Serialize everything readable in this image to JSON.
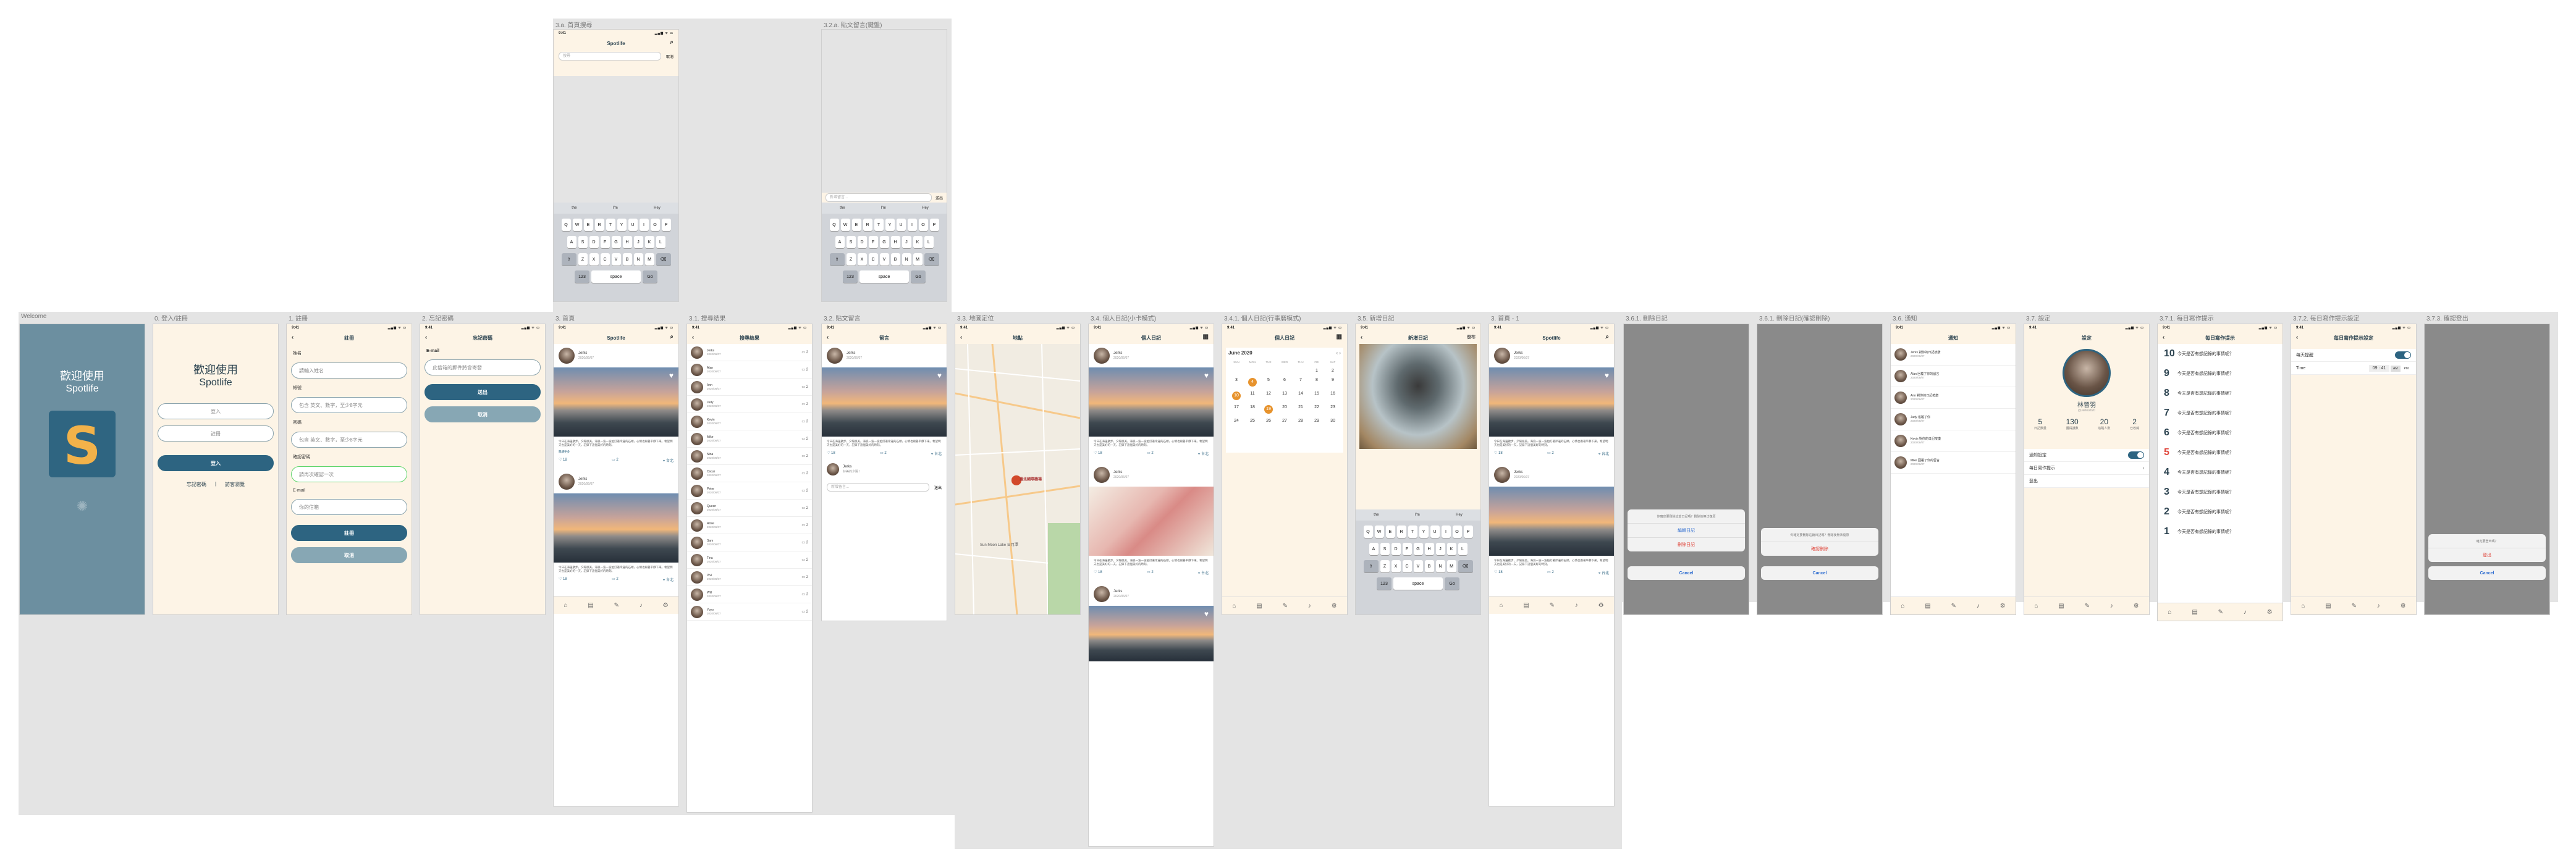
{
  "frames": {
    "welcome": "Welcome",
    "login_register": "0. 登入/註冊",
    "register": "1. 註冊",
    "forgot": "2. 忘記密碼",
    "home": "3. 首頁",
    "home_search": "3.a. 首頁搜尋",
    "home_search_detail": "3.1. 搜尋結果",
    "comment": "3.2. 貼文留言",
    "comment_keyboard": "3.2.a. 貼文留言(鍵盤)",
    "map": "3.3. 地圖定位",
    "personal": "3.4. 個人日記(小卡模式)",
    "personal_cal": "3.4.1. 個人日記(行事曆模式)",
    "new_diary": "3.5. 新增日記",
    "home_v1": "3. 首頁 - 1",
    "del1": "3.6.1. 刪除日記",
    "del2": "3.6.1. 刪除日記(確認刪除)",
    "notify": "3.6. 通知",
    "settings": "3.7. 設定",
    "remind_time": "3.7.1. 每日寫作提示",
    "remind_set": "3.7.2. 每日寫作提示設定",
    "logout": "3.7.3. 確認登出"
  },
  "status": {
    "time": "9:41",
    "bars": "▂▄▆ ᯤ ▭"
  },
  "welcome": {
    "title": "歡迎使用",
    "app": "Spotlife",
    "logo": "S"
  },
  "login": {
    "title": "歡迎使用",
    "app": "Spotlife",
    "signin": "登入",
    "register": "註冊",
    "login_btn": "登入",
    "forgot": "忘記密碼",
    "guest": "訪客瀏覽"
  },
  "register": {
    "nav": "註冊",
    "name_label": "姓名",
    "name_ph": "請輸入姓名",
    "account_label": "帳號",
    "account_ph": "包含 英文、數字，至少8字元",
    "password_label": "密碼",
    "password_ph": "包含 英文、數字，至少8字元",
    "confirm_label": "確認密碼",
    "confirm_ph": "請再次確認一次",
    "email_label": "E-mail",
    "email_ph": "你的信箱",
    "submit": "註冊",
    "cancel": "取消"
  },
  "forgot": {
    "nav": "忘記密碼",
    "email_label": "E-mail",
    "email_ph": "此信箱的郵件將會寄發",
    "send": "送出",
    "cancel": "取消"
  },
  "home": {
    "nav": "Spotlife",
    "user": "Jerks",
    "date": "2020/06/07",
    "likes": "18",
    "comments": "2",
    "loc": "台北",
    "text": "今日在海邊散步，夕陽很美。海浪一波一波拍打著岸邊的石頭，心情也跟著平靜下來。希望明天也是美好的一天，記錄下這個美好的時刻。",
    "more": "閱讀更多"
  },
  "search": {
    "placeholder": "搜尋",
    "cancel": "取消",
    "result_nav": "搜尋結果"
  },
  "results": [
    "Jerks",
    "Alan",
    "Ann",
    "Judy",
    "Kevin",
    "Mike",
    "Nina",
    "Oscar",
    "Peter",
    "Queen",
    "Rose",
    "Sam",
    "Tina",
    "Vivi",
    "Will",
    "Yoyo"
  ],
  "comment": {
    "nav": "留言",
    "placeholder": "新增留言...",
    "send": "送出",
    "author": "Jerks",
    "reply": "好美的夕陽！"
  },
  "map": {
    "nav": "地點",
    "place": "Sun Moon Lake 日月潭",
    "pin": "臺北國際機場"
  },
  "personal": {
    "nav": "個人日記",
    "month": "June 2020"
  },
  "new_diary": {
    "nav": "新增日記",
    "post": "發布"
  },
  "calendar": {
    "days": [
      "SUN",
      "MON",
      "TUE",
      "WED",
      "THU",
      "FRI",
      "SAT"
    ],
    "dates": [
      "",
      "",
      "",
      "",
      "",
      "1",
      "2",
      "3",
      "4",
      "5",
      "6",
      "7",
      "8",
      "9",
      "10",
      "11",
      "12",
      "13",
      "14",
      "15",
      "16",
      "17",
      "18",
      "19",
      "20",
      "21",
      "22",
      "23",
      "24",
      "25",
      "26",
      "27",
      "28",
      "29",
      "30",
      "",
      "",
      ""
    ],
    "marked": [
      "4",
      "10",
      "19"
    ]
  },
  "delete": {
    "message": "你確定要刪除這篇日記嗎？刪除後無法復原",
    "edit": "編輯日記",
    "delete": "刪除日記",
    "cancel": "Cancel",
    "confirm": "確認刪除"
  },
  "notify": {
    "nav": "通知",
    "items": [
      "Jerks 對你的日記按讚",
      "Alan 回覆了你的留言",
      "Ann 對你的日記按讚",
      "Judy 追蹤了你",
      "Kevin 對你的日記按讚",
      "Mike 回覆了你的留言"
    ]
  },
  "settings": {
    "nav": "設定",
    "name": "林晉羽",
    "id": "@Jerks2020",
    "stats": [
      {
        "v": "5",
        "k": "日記數量"
      },
      {
        "v": "130",
        "k": "獲得讚數"
      },
      {
        "v": "20",
        "k": "追蹤人數"
      },
      {
        "v": "2",
        "k": "已收藏"
      }
    ],
    "items": [
      "通知設定",
      "每日寫作提示",
      "登出"
    ]
  },
  "remind": {
    "nav": "每日寫作提示",
    "hours": [
      "10",
      "9",
      "8",
      "7",
      "6",
      "5",
      "4",
      "3",
      "2",
      "1"
    ],
    "text": "今天是否有想記錄的事情呢？"
  },
  "remind_set": {
    "nav": "每日寫作提示設定",
    "switch": "每天提醒",
    "time_label": "Time",
    "time": "09 : 41",
    "am": "AM",
    "pm": "PM"
  },
  "logout": {
    "message": "確定要登出嗎？",
    "confirm": "登出",
    "cancel": "Cancel"
  },
  "keyboard": {
    "row1": [
      "Q",
      "W",
      "E",
      "R",
      "T",
      "Y",
      "U",
      "I",
      "O",
      "P"
    ],
    "row2": [
      "A",
      "S",
      "D",
      "F",
      "G",
      "H",
      "J",
      "K",
      "L"
    ],
    "row3": [
      "Z",
      "X",
      "C",
      "V",
      "B",
      "N",
      "M"
    ],
    "sug": [
      "the",
      "I'm",
      "Hey"
    ],
    "space": "space",
    "num": "123",
    "go": "Go"
  },
  "tabs": [
    "⌂",
    "▤",
    "✎",
    "♪",
    "⚙"
  ],
  "colors": {
    "primary": "#2d6481",
    "accent": "#e7932d",
    "bg": "#fdf4e6"
  }
}
